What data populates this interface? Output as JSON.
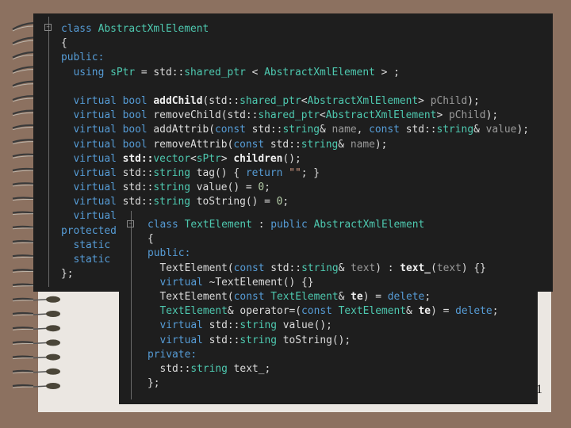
{
  "slide": {
    "number": "1"
  },
  "colors": {
    "background": "#8c7160",
    "paper": "#ebe7e2",
    "editor": "#1e1e1e",
    "keyword": "#569cd6",
    "type": "#4ec9b0",
    "param": "#9a9a9a",
    "number": "#b5cea8",
    "string": "#d69d85"
  },
  "icons": {
    "fold": "collapse-minus-icon",
    "binding": "spiral-ring-icon"
  },
  "panel1": {
    "lines": [
      [
        [
          "class ",
          "k"
        ],
        [
          "AbstractXmlElement",
          "t"
        ]
      ],
      [
        [
          "{",
          "d"
        ]
      ],
      [
        [
          "public:",
          "k"
        ]
      ],
      [
        [
          "  using ",
          "k"
        ],
        [
          "sPtr",
          "t"
        ],
        [
          " = std::",
          "d"
        ],
        [
          "shared_ptr",
          "t"
        ],
        [
          " < ",
          "d"
        ],
        [
          "AbstractXmlElement",
          "t"
        ],
        [
          " > ;",
          "d"
        ]
      ],
      [],
      [
        [
          "  virtual ",
          "k"
        ],
        [
          "bool ",
          "k"
        ],
        [
          "addChild",
          "b"
        ],
        [
          "(std::",
          "d"
        ],
        [
          "shared_ptr",
          "t"
        ],
        [
          "<",
          "d"
        ],
        [
          "AbstractXmlElement",
          "t"
        ],
        [
          "> ",
          "d"
        ],
        [
          "pChild",
          "p"
        ],
        [
          ");",
          "d"
        ]
      ],
      [
        [
          "  virtual ",
          "k"
        ],
        [
          "bool ",
          "k"
        ],
        [
          "removeChild",
          "d"
        ],
        [
          "(std::",
          "d"
        ],
        [
          "shared_ptr",
          "t"
        ],
        [
          "<",
          "d"
        ],
        [
          "AbstractXmlElement",
          "t"
        ],
        [
          "> ",
          "d"
        ],
        [
          "pChild",
          "p"
        ],
        [
          ");",
          "d"
        ]
      ],
      [
        [
          "  virtual ",
          "k"
        ],
        [
          "bool ",
          "k"
        ],
        [
          "addAttrib",
          "d"
        ],
        [
          "(",
          "d"
        ],
        [
          "const ",
          "k"
        ],
        [
          "std::",
          "d"
        ],
        [
          "string",
          "t"
        ],
        [
          "& ",
          "d"
        ],
        [
          "name",
          "p"
        ],
        [
          ", ",
          "d"
        ],
        [
          "const ",
          "k"
        ],
        [
          "std::",
          "d"
        ],
        [
          "string",
          "t"
        ],
        [
          "& ",
          "d"
        ],
        [
          "value",
          "p"
        ],
        [
          ");",
          "d"
        ]
      ],
      [
        [
          "  virtual ",
          "k"
        ],
        [
          "bool ",
          "k"
        ],
        [
          "removeAttrib",
          "d"
        ],
        [
          "(",
          "d"
        ],
        [
          "const ",
          "k"
        ],
        [
          "std::",
          "d"
        ],
        [
          "string",
          "t"
        ],
        [
          "& ",
          "d"
        ],
        [
          "name",
          "p"
        ],
        [
          ");",
          "d"
        ]
      ],
      [
        [
          "  virtual ",
          "k"
        ],
        [
          "std::",
          "b"
        ],
        [
          "vector",
          "t"
        ],
        [
          "<",
          "d"
        ],
        [
          "sPtr",
          "t"
        ],
        [
          "> ",
          "d"
        ],
        [
          "children",
          "b"
        ],
        [
          "();",
          "d"
        ]
      ],
      [
        [
          "  virtual ",
          "k"
        ],
        [
          "std::",
          "d"
        ],
        [
          "string",
          "t"
        ],
        [
          " tag() { ",
          "d"
        ],
        [
          "return ",
          "k"
        ],
        [
          "\"\"",
          "s"
        ],
        [
          "; }",
          "d"
        ]
      ],
      [
        [
          "  virtual ",
          "k"
        ],
        [
          "std::",
          "d"
        ],
        [
          "string",
          "t"
        ],
        [
          " value() = ",
          "d"
        ],
        [
          "0",
          "n"
        ],
        [
          ";",
          "d"
        ]
      ],
      [
        [
          "  virtual ",
          "k"
        ],
        [
          "std::",
          "d"
        ],
        [
          "string",
          "t"
        ],
        [
          " toString() = ",
          "d"
        ],
        [
          "0",
          "n"
        ],
        [
          ";",
          "d"
        ]
      ],
      [
        [
          "  virtual ",
          "k"
        ]
      ],
      [
        [
          "protected",
          "k"
        ]
      ],
      [
        [
          "  static ",
          "k"
        ]
      ],
      [
        [
          "  static ",
          "k"
        ]
      ],
      [
        [
          "};",
          "d"
        ]
      ]
    ]
  },
  "panel2": {
    "lines": [
      [
        [
          "class ",
          "k"
        ],
        [
          "TextElement",
          "t"
        ],
        [
          " : ",
          "d"
        ],
        [
          "public ",
          "k"
        ],
        [
          "AbstractXmlElement",
          "t"
        ]
      ],
      [
        [
          "{",
          "d"
        ]
      ],
      [
        [
          "public:",
          "k"
        ]
      ],
      [
        [
          "  TextElement",
          "d"
        ],
        [
          "(",
          "d"
        ],
        [
          "const ",
          "k"
        ],
        [
          "std::",
          "d"
        ],
        [
          "string",
          "t"
        ],
        [
          "& ",
          "d"
        ],
        [
          "text",
          "p"
        ],
        [
          ") : ",
          "d"
        ],
        [
          "text_",
          "b"
        ],
        [
          "(",
          "d"
        ],
        [
          "text",
          "p"
        ],
        [
          ") {}",
          "d"
        ]
      ],
      [
        [
          "  virtual ",
          "k"
        ],
        [
          "~TextElement() {}",
          "d"
        ]
      ],
      [
        [
          "  TextElement",
          "d"
        ],
        [
          "(",
          "d"
        ],
        [
          "const ",
          "k"
        ],
        [
          "TextElement",
          "t"
        ],
        [
          "& ",
          "d"
        ],
        [
          "te",
          "b"
        ],
        [
          ") = ",
          "d"
        ],
        [
          "delete",
          "k"
        ],
        [
          ";",
          "d"
        ]
      ],
      [
        [
          "  TextElement",
          "t"
        ],
        [
          "& operator=(",
          "d"
        ],
        [
          "const ",
          "k"
        ],
        [
          "TextElement",
          "t"
        ],
        [
          "& ",
          "d"
        ],
        [
          "te",
          "b"
        ],
        [
          ") = ",
          "d"
        ],
        [
          "delete",
          "k"
        ],
        [
          ";",
          "d"
        ]
      ],
      [
        [
          "  virtual ",
          "k"
        ],
        [
          "std::",
          "d"
        ],
        [
          "string",
          "t"
        ],
        [
          " value();",
          "d"
        ]
      ],
      [
        [
          "  virtual ",
          "k"
        ],
        [
          "std::",
          "d"
        ],
        [
          "string",
          "t"
        ],
        [
          " toString();",
          "d"
        ]
      ],
      [
        [
          "private:",
          "k"
        ]
      ],
      [
        [
          "  std::",
          "d"
        ],
        [
          "string",
          "t"
        ],
        [
          " text_;",
          "d"
        ]
      ],
      [
        [
          "};",
          "d"
        ]
      ]
    ]
  }
}
